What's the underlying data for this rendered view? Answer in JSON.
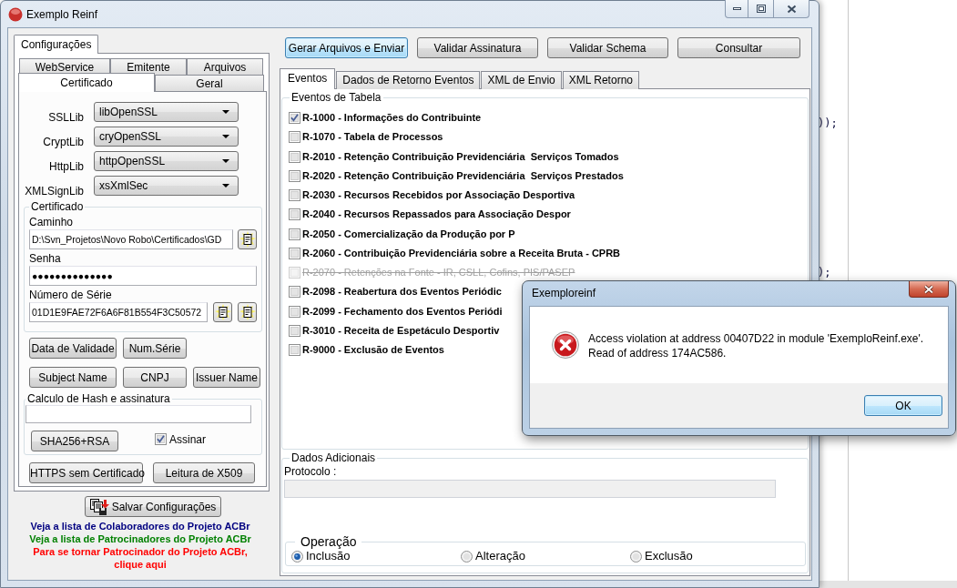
{
  "window": {
    "title": "Exemplo Reinf"
  },
  "config": {
    "page_tab": {
      "label": "Configurações",
      "selected": true
    },
    "tab_rows": [
      [
        {
          "label": "WebService",
          "selected": false
        },
        {
          "label": "Emitente",
          "selected": false
        },
        {
          "label": "Arquivos",
          "selected": false
        }
      ],
      [
        {
          "label": "Certificado",
          "selected": true
        },
        {
          "label": "Geral",
          "selected": false
        }
      ]
    ],
    "libs": [
      {
        "label": "SSLLib",
        "value": "libOpenSSL"
      },
      {
        "label": "CryptLib",
        "value": "cryOpenSSL"
      },
      {
        "label": "HttpLib",
        "value": "httpOpenSSL"
      },
      {
        "label": "XMLSignLib",
        "value": "xsXmlSec"
      }
    ],
    "certificado": {
      "title": "Certificado",
      "fields": [
        {
          "kind": "path",
          "label": "Caminho",
          "value": "D:\\Svn_Projetos\\Novo Robo\\Certificados\\GD"
        },
        {
          "kind": "password",
          "label": "Senha",
          "value": "●●●●●●●●●●●●●●"
        },
        {
          "kind": "serial",
          "label": "Número de Série",
          "value": "01D1E9FAE72F6A6F81B554F3C50572"
        }
      ]
    },
    "cert_buttons": [
      [
        "Data de Validade",
        "Num.Série"
      ],
      [
        "Subject Name",
        "CNPJ",
        "Issuer Name"
      ]
    ],
    "hash": {
      "title": "Calculo de Hash e assinatura",
      "button": "SHA256+RSA",
      "checkbox": {
        "label": "Assinar",
        "checked": true
      }
    },
    "extra_buttons": [
      "HTTPS sem Certificado",
      "Leitura de X509"
    ],
    "save_button": "Salvar Configurações",
    "links": [
      {
        "text": "Veja a lista de Colaboradores do Projeto ACBr",
        "color": "#000080"
      },
      {
        "text": "Veja a lista de Patrocinadores do Projeto ACBr",
        "color": "#008000"
      },
      {
        "text": "Para se tornar Patrocinador do Projeto ACBr, clique aqui",
        "color": "#ff0000"
      }
    ]
  },
  "main": {
    "actions": [
      {
        "label": "Gerar Arquivos e Enviar",
        "focused": true
      },
      {
        "label": "Validar Assinatura",
        "focused": false
      },
      {
        "label": "Validar Schema",
        "focused": false
      },
      {
        "label": "Consultar",
        "focused": false
      }
    ],
    "tabs": [
      {
        "label": "Eventos",
        "selected": true
      },
      {
        "label": "Dados de Retorno Eventos",
        "selected": false
      },
      {
        "label": "XML de Envio",
        "selected": false
      },
      {
        "label": "XML Retorno",
        "selected": false
      }
    ],
    "eventos": {
      "title": "Eventos de Tabela",
      "items": [
        {
          "label": "R-1000 - Informações do Contribuinte",
          "checked": true,
          "disabled": false
        },
        {
          "label": "R-1070 - Tabela de Processos",
          "checked": false,
          "disabled": false
        },
        {
          "label": "R-2010 - Retenção Contribuição Previdenciária  Serviços Tomados",
          "checked": false,
          "disabled": false
        },
        {
          "label": "R-2020 - Retenção Contribuição Previdenciária  Serviços Prestados",
          "checked": false,
          "disabled": false
        },
        {
          "label": "R-2030 - Recursos Recebidos por Associação Desportiva",
          "checked": false,
          "disabled": false
        },
        {
          "label": "R-2040 - Recursos Repassados para Associação Despor",
          "checked": false,
          "disabled": false
        },
        {
          "label": "R-2050 - Comercialização da Produção por P",
          "checked": false,
          "disabled": false
        },
        {
          "label": "R-2060 - Contribuição Previdenciária sobre a Receita Bruta - CPRB",
          "checked": false,
          "disabled": false
        },
        {
          "label": "R-2070 - Retenções na Fonte - IR, CSLL, Cofins, PIS/PASEP",
          "checked": false,
          "disabled": true
        },
        {
          "label": "R-2098 - Reabertura dos Eventos Periódic",
          "checked": false,
          "disabled": false
        },
        {
          "label": "R-2099 - Fechamento dos Eventos Periódi",
          "checked": false,
          "disabled": false
        },
        {
          "label": "R-3010 - Receita de Espetáculo Desportiv",
          "checked": false,
          "disabled": false
        },
        {
          "label": "R-9000 - Exclusão de Eventos",
          "checked": false,
          "disabled": false
        }
      ]
    },
    "dados": {
      "title": "Dados Adicionais",
      "protocolo_label": "Protocolo :"
    },
    "operacao": {
      "title": "Operação",
      "options": [
        {
          "label": "Inclusão",
          "selected": true
        },
        {
          "label": "Alteração",
          "selected": false
        },
        {
          "label": "Exclusão",
          "selected": false
        }
      ]
    }
  },
  "dialog": {
    "title": "Exemploreinf",
    "message": "Access violation at address 00407D22 in module 'ExemploReinf.exe'.\nRead of address 174AC586.",
    "button": "OK"
  },
  "editor": {
    "lines": [
      "));",
      ");"
    ]
  }
}
